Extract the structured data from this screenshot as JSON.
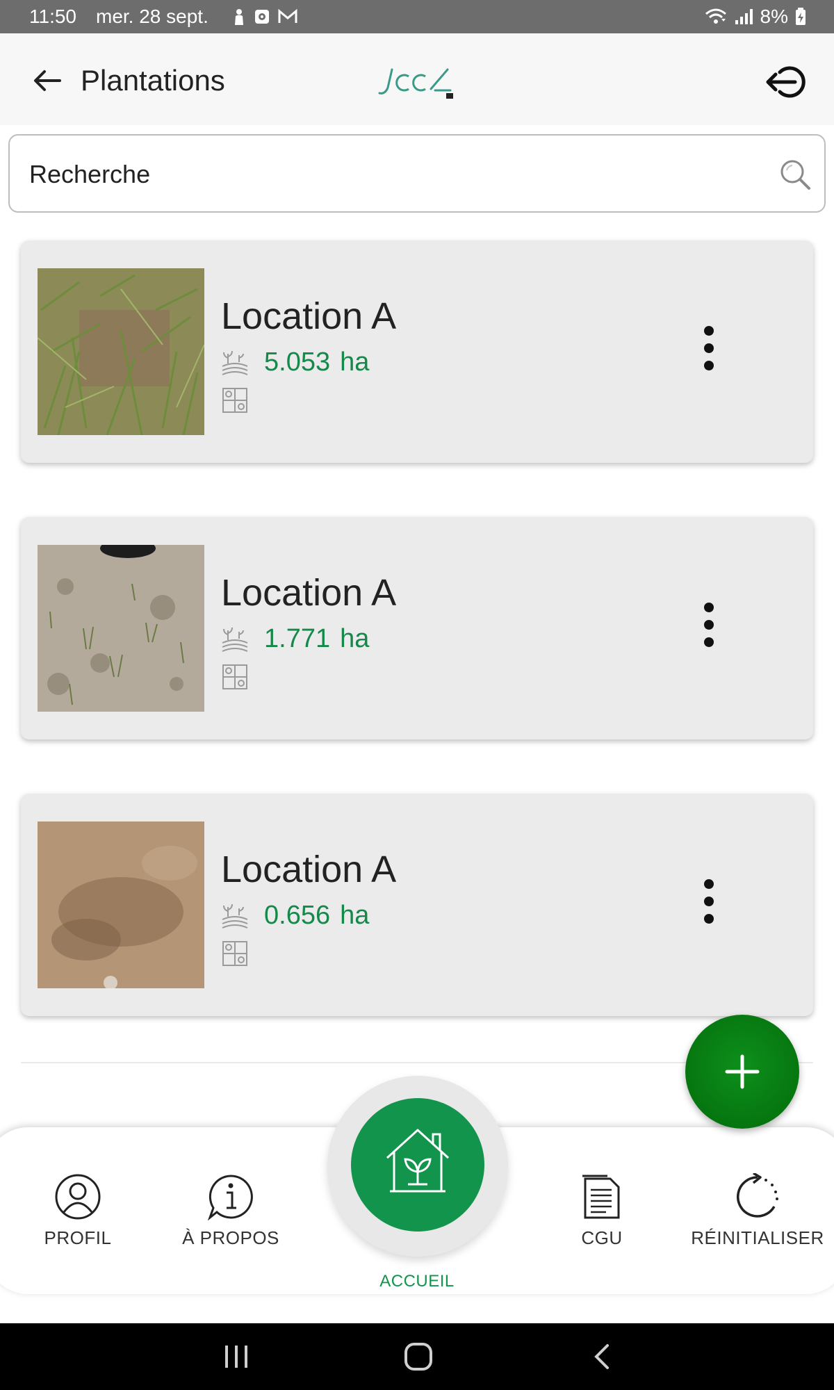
{
  "status_bar": {
    "time": "11:50",
    "date": "mer. 28 sept.",
    "battery": "8%",
    "icons": [
      "person-icon",
      "camera-app-icon",
      "gmail-icon",
      "wifi-icon",
      "signal-icon",
      "battery-charging-icon"
    ]
  },
  "app_bar": {
    "back_icon": "arrow-left-icon",
    "title": "Plantations",
    "logo_icon": "jool-logo",
    "logout_icon": "logout-icon"
  },
  "search": {
    "placeholder": "Recherche",
    "icon": "search-icon"
  },
  "plantations": [
    {
      "name": "Location A",
      "area": "5.053",
      "unit": "ha",
      "photo": "grass-ground-photo"
    },
    {
      "name": "Location A",
      "area": "1.771",
      "unit": "ha",
      "photo": "dry-soil-photo"
    },
    {
      "name": "Location A",
      "area": "0.656",
      "unit": "ha",
      "photo": "bare-earth-photo"
    }
  ],
  "fab": {
    "icon": "plus-icon"
  },
  "bottom_nav": {
    "items": [
      {
        "label": "PROFIL",
        "icon": "user-circle-icon"
      },
      {
        "label": "À PROPOS",
        "icon": "info-bubble-icon"
      },
      {
        "label": "ACCUEIL",
        "icon": "home-plant-icon",
        "active": true
      },
      {
        "label": "CGU",
        "icon": "document-icon"
      },
      {
        "label": "RÉINITIALISER",
        "icon": "reset-icon"
      }
    ]
  },
  "colors": {
    "accent_green": "#13944d",
    "fab_green": "#06760f",
    "area_text": "#15894a",
    "status_bar": "#6d6d6d",
    "card_bg": "#ebebeb"
  }
}
